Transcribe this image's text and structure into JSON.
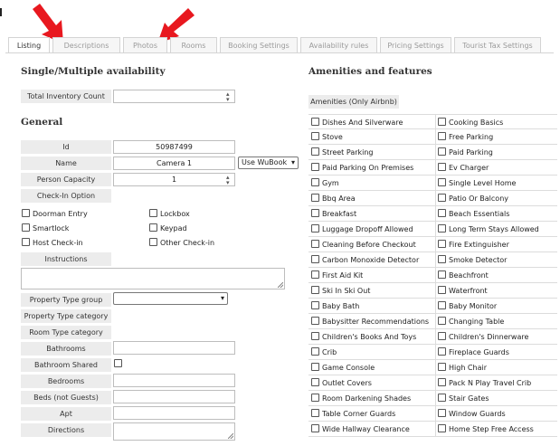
{
  "tabs": [
    "Listing",
    "Descriptions",
    "Photos",
    "Rooms",
    "Booking Settings",
    "Availability rules",
    "Pricing Settings",
    "Tourist Tax Settings"
  ],
  "active_tab": "Listing",
  "availability": {
    "title": "Single/Multiple availability",
    "total_inventory_label": "Total Inventory Count",
    "total_inventory_value": ""
  },
  "general": {
    "title": "General",
    "id_label": "Id",
    "id_value": "50987499",
    "name_label": "Name",
    "name_value": "Camera 1",
    "name_select": "Use WuBook",
    "capacity_label": "Person Capacity",
    "capacity_value": "1",
    "checkin_label": "Check-In Option",
    "checkin_options": [
      {
        "label": "Doorman Entry",
        "checked": false
      },
      {
        "label": "Lockbox",
        "checked": false
      },
      {
        "label": "Smartlock",
        "checked": false
      },
      {
        "label": "Keypad",
        "checked": false
      },
      {
        "label": "Host Check-in",
        "checked": false
      },
      {
        "label": "Other Check-in",
        "checked": false
      }
    ],
    "instructions_label": "Instructions",
    "property_type_group_label": "Property Type group",
    "property_type_category_label": "Property Type category",
    "room_type_category_label": "Room Type category",
    "bathrooms_label": "Bathrooms",
    "bathroom_shared_label": "Bathroom Shared",
    "bedrooms_label": "Bedrooms",
    "beds_label": "Beds (not Guests)",
    "apt_label": "Apt",
    "directions_label": "Directions"
  },
  "amenities": {
    "title": "Amenities and features",
    "subtitle": "Amenities (Only Airbnb)",
    "rows": [
      [
        "Dishes And Silverware",
        "Cooking Basics"
      ],
      [
        "Stove",
        "Free Parking"
      ],
      [
        "Street Parking",
        "Paid Parking"
      ],
      [
        "Paid Parking On Premises",
        "Ev Charger"
      ],
      [
        "Gym",
        "Single Level Home"
      ],
      [
        "Bbq Area",
        "Patio Or Balcony"
      ],
      [
        "Breakfast",
        "Beach Essentials"
      ],
      [
        "Luggage Dropoff Allowed",
        "Long Term Stays Allowed"
      ],
      [
        "Cleaning Before Checkout",
        "Fire Extinguisher"
      ],
      [
        "Carbon Monoxide Detector",
        "Smoke Detector"
      ],
      [
        "First Aid Kit",
        "Beachfront"
      ],
      [
        "Ski In Ski Out",
        "Waterfront"
      ],
      [
        "Baby Bath",
        "Baby Monitor"
      ],
      [
        "Babysitter Recommendations",
        "Changing Table"
      ],
      [
        "Children's Books And Toys",
        "Children's Dinnerware"
      ],
      [
        "Crib",
        "Fireplace Guards"
      ],
      [
        "Game Console",
        "High Chair"
      ],
      [
        "Outlet Covers",
        "Pack N Play Travel Crib"
      ],
      [
        "Room Darkening Shades",
        "Stair Gates"
      ],
      [
        "Table Corner Guards",
        "Window Guards"
      ],
      [
        "Wide Hallway Clearance",
        "Home Step Free Access"
      ]
    ]
  },
  "colors": {
    "arrow": "#e8181f",
    "label_bg": "#ececec",
    "border": "#d4d4d4"
  }
}
